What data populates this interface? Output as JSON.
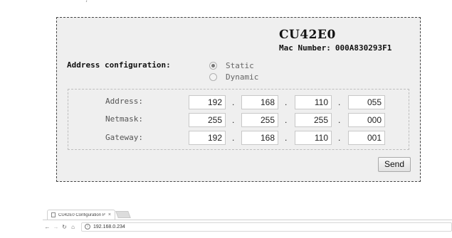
{
  "device": {
    "name": "CU42E0",
    "mac_label": "Mac Number:",
    "mac_value": "000A830293F1"
  },
  "address_config": {
    "label": "Address configuration:",
    "options": [
      {
        "label": "Static",
        "selected": true
      },
      {
        "label": "Dynamic",
        "selected": false
      }
    ]
  },
  "ip_settings": {
    "address_label": "Address:",
    "address": [
      "192",
      "168",
      "110",
      "055"
    ],
    "netmask_label": "Netmask:",
    "netmask": [
      "255",
      "255",
      "255",
      "000"
    ],
    "gateway_label": "Gateway:",
    "gateway": [
      "192",
      "168",
      "110",
      "001"
    ],
    "separator": "."
  },
  "send_label": "Send",
  "browser": {
    "tab_title": "CU42E0 Configuration P",
    "tab_close": "×",
    "url": "192.168.0.234",
    "colors": {
      "page_bg": "#efefef",
      "border": "#444444"
    }
  }
}
